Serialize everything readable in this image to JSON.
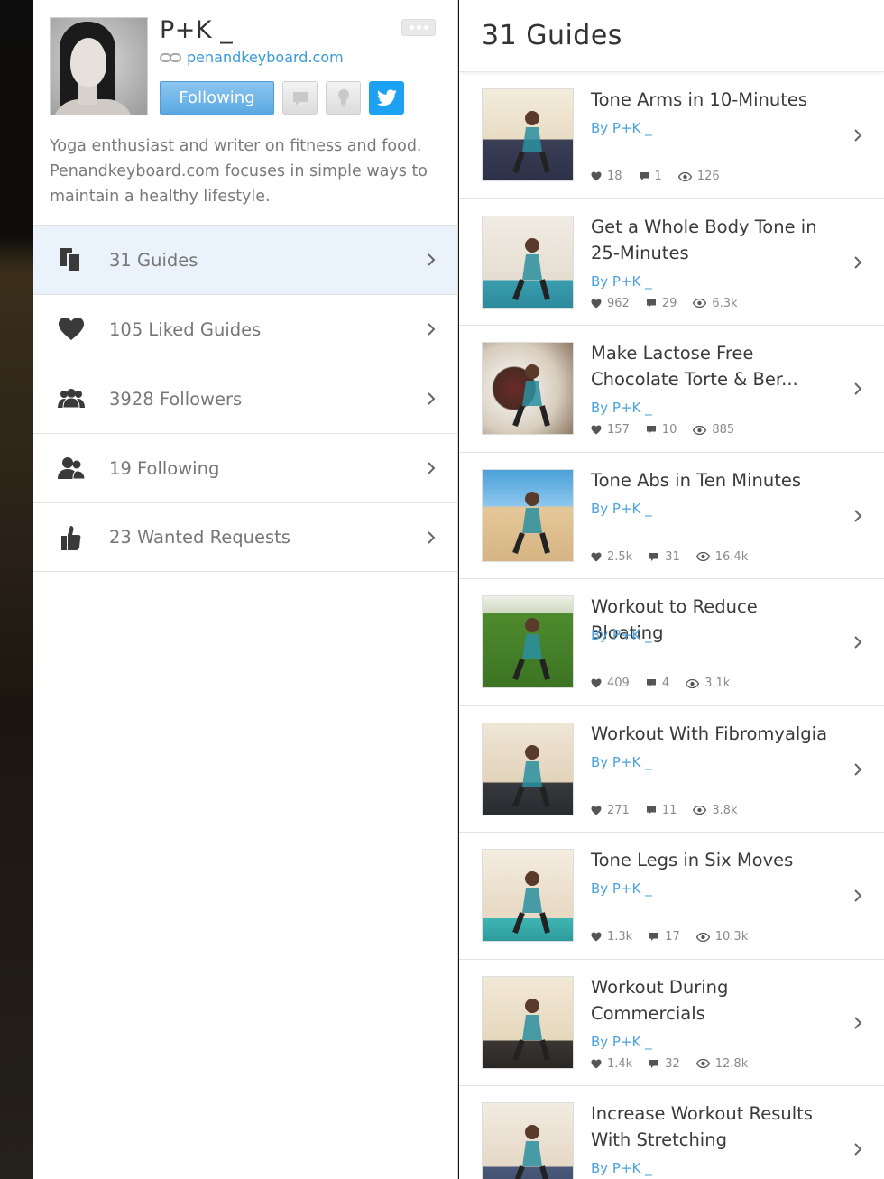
{
  "profile": {
    "name": "P+K _",
    "website": "penandkeyboard.com",
    "follow_label": "Following",
    "bio": "Yoga enthusiast and writer on fitness and food. Penandkeyboard.com focuses in simple ways to maintain a healthy lifestyle."
  },
  "menu": [
    {
      "label": "31 Guides",
      "icon": "guides-icon"
    },
    {
      "label": "105 Liked Guides",
      "icon": "heart-icon"
    },
    {
      "label": "3928 Followers",
      "icon": "followers-icon"
    },
    {
      "label": "19 Following",
      "icon": "following-icon"
    },
    {
      "label": "23 Wanted Requests",
      "icon": "thumbs-up-icon"
    }
  ],
  "guides_header": "31 Guides",
  "guides": [
    {
      "title": "Tone Arms in 10-Minutes",
      "author": "By P+K _",
      "likes": "18",
      "comments": "1",
      "views": "126",
      "lines": 1
    },
    {
      "title": "Get a Whole Body Tone in 25-Minutes",
      "author": "By P+K _",
      "likes": "962",
      "comments": "29",
      "views": "6.3k",
      "lines": 2
    },
    {
      "title": "Make Lactose Free Chocolate Torte & Ber...",
      "author": "By P+K _",
      "likes": "157",
      "comments": "10",
      "views": "885",
      "lines": 2
    },
    {
      "title": "Tone Abs in Ten Minutes",
      "author": "By P+K _",
      "likes": "2.5k",
      "comments": "31",
      "views": "16.4k",
      "lines": 1
    },
    {
      "title": "Workout to Reduce Bloating",
      "author": "By P+K _",
      "likes": "409",
      "comments": "4",
      "views": "3.1k",
      "lines": 1
    },
    {
      "title": "Workout With Fibromyalgia",
      "author": "By P+K _",
      "likes": "271",
      "comments": "11",
      "views": "3.8k",
      "lines": 1
    },
    {
      "title": "Tone Legs in Six Moves",
      "author": "By P+K _",
      "likes": "1.3k",
      "comments": "17",
      "views": "10.3k",
      "lines": 1
    },
    {
      "title": "Workout During Commercials",
      "author": "By P+K _",
      "likes": "1.4k",
      "comments": "32",
      "views": "12.8k",
      "lines": 2
    },
    {
      "title": "Increase Workout Results With Stretching",
      "author": "By P+K _",
      "likes": "",
      "comments": "",
      "views": "",
      "lines": 2
    }
  ],
  "colors": {
    "accent": "#3a9ad9",
    "twitter": "#1da1f2",
    "active_row": "#eaf3fb"
  }
}
